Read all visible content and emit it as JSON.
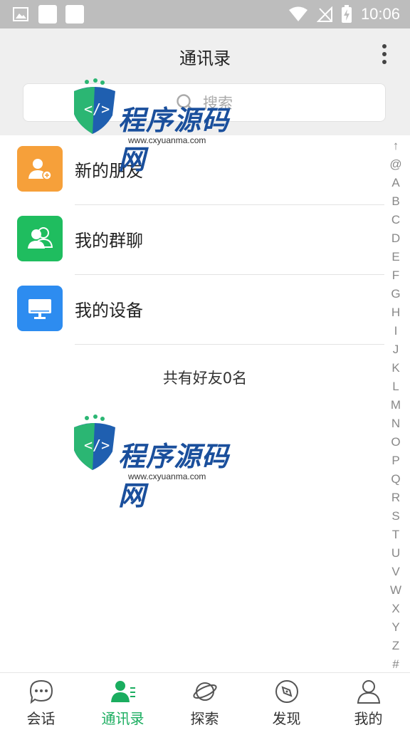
{
  "status_bar": {
    "time": "10:06"
  },
  "header": {
    "title": "通讯录"
  },
  "search": {
    "placeholder": "搜索"
  },
  "entries": [
    {
      "label": "新的朋友",
      "icon": "add-friend-icon",
      "color": "#f6a03a"
    },
    {
      "label": "我的群聊",
      "icon": "group-chat-icon",
      "color": "#1fbd5f"
    },
    {
      "label": "我的设备",
      "icon": "monitor-icon",
      "color": "#2d8cf0"
    }
  ],
  "friend_count_text": "共有好友0名",
  "index_letters": [
    "↑",
    "@",
    "A",
    "B",
    "C",
    "D",
    "E",
    "F",
    "G",
    "H",
    "I",
    "J",
    "K",
    "L",
    "M",
    "N",
    "O",
    "P",
    "Q",
    "R",
    "S",
    "T",
    "U",
    "V",
    "W",
    "X",
    "Y",
    "Z",
    "#"
  ],
  "watermark": {
    "text": "程序源码网",
    "url": "www.cxyuanma.com"
  },
  "tabs": [
    {
      "label": "会话",
      "icon": "chat-bubble-icon",
      "active": false
    },
    {
      "label": "通讯录",
      "icon": "contacts-icon",
      "active": true
    },
    {
      "label": "探索",
      "icon": "planet-icon",
      "active": false
    },
    {
      "label": "发现",
      "icon": "compass-icon",
      "active": false
    },
    {
      "label": "我的",
      "icon": "person-icon",
      "active": false
    }
  ],
  "colors": {
    "accent": "#1aad5f",
    "header_bg": "#efefef",
    "status_bar_bg": "#bdbdbd"
  }
}
